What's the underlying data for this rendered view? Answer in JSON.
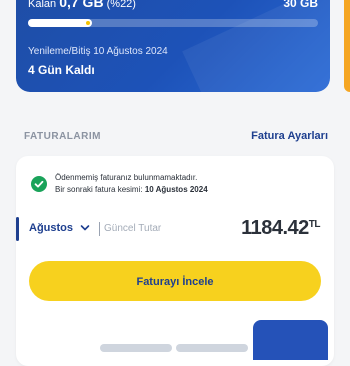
{
  "package": {
    "remaining_label": "Kalan",
    "remaining_amount": "0,7 GB",
    "remaining_percent_text": "(%22)",
    "remaining_fraction": 0.22,
    "total": "30 GB",
    "renewal_text": "Yenileme/Bitiş 10 Ağustos 2024",
    "days_left": "4 Gün Kaldı"
  },
  "invoices": {
    "section_title": "FATURALARIM",
    "settings_link": "Fatura Ayarları",
    "notice_line1": "Ödenmemiş faturanız bulunmamaktadır.",
    "notice_line2_prefix": "Bir sonraki fatura kesimi: ",
    "notice_line2_date": "10 Ağustos 2024",
    "month": "Ağustos",
    "current_amount_label": "Güncel Tutar",
    "amount": "1184.42",
    "currency": "TL",
    "review_button": "Faturayı İncele"
  },
  "colors": {
    "brand_blue": "#1e3f8f",
    "accent_yellow": "#f7d11e",
    "success_green": "#1aa35a",
    "accent_orange": "#f5a623"
  },
  "icons": {
    "check": "check-circle-icon",
    "chevron": "chevron-down-icon"
  }
}
